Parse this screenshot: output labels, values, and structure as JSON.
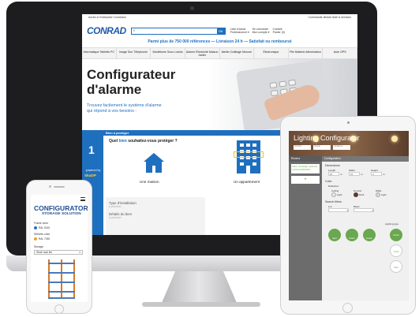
{
  "desktop": {
    "topbar_left": "Accès à l'entreprise   Connexion",
    "topbar_right": "Commande directe   Aide & services",
    "logo": "CONRAD",
    "search_placeholder": "",
    "search_button": "OK",
    "tools": [
      {
        "top": "Liste d'achat",
        "bottom": "Professionnel ▾"
      },
      {
        "top": "Se connecter",
        "bottom": "Mon compte ▾"
      },
      {
        "top": "0 article",
        "bottom": "Panier (0)"
      }
    ],
    "promo": "Parmi plus de 750 000 références — Livraison 24 h — Satisfait ou remboursé",
    "nav": [
      "Informatique Tablette PC",
      "Image Son Téléphonie",
      "Modélisme Sono Loisirs",
      "Alarme Électricité Maison Jardin",
      "Atelier Outillage Mesure",
      "Électronique",
      "Pile Batterie Alimentation",
      "Auto GPS"
    ],
    "hero_title_1": "Configurateur",
    "hero_title_2": "d'alarme",
    "hero_text": "Trouvez facilement le système d'alarme qui répond à vos besoins :",
    "step_bar": "Bien à protéger",
    "step_num": "1",
    "step_sub": "powered by",
    "step_brand": "SkuDP",
    "question_1": "Quel",
    "question_link": "bien",
    "question_2": "souhaitez-vous protéger ?",
    "option_house": "Une maison",
    "option_apartment": "Un appartement",
    "form_install_label": "Type d'installation",
    "form_install_value": "à préciser",
    "form_details_label": "Détails du bien",
    "form_details_value": "à préciser"
  },
  "tablet": {
    "title": "Lighting Configurator",
    "fields": [
      "Nombre",
      "Niveau",
      "Ambiance"
    ],
    "rooms_header": "Rooms",
    "room_item": "Salon (rectangle, plafond) CONFIGURATION",
    "add_button": "+",
    "config_header": "Configuration",
    "dimensions_label": "Dimensions",
    "dim_labels": [
      "Length",
      "Width",
      "Height"
    ],
    "dim_values": [
      "10",
      "15",
      "3"
    ],
    "dim_units": [
      "m",
      "m",
      "m"
    ],
    "color_label": "Color",
    "reflection_label": "Reflection",
    "reflection_options": [
      "Ceiling",
      "Ground",
      "Walls"
    ],
    "reflection_values": [
      "Light",
      "Dark",
      "Light"
    ],
    "search_filters_label": "Search filters",
    "filter_labels": [
      "Lux",
      "Beam"
    ],
    "lighting_type_label": "Lighting type",
    "lighting_types": [
      "Spot",
      "Down",
      "Linear",
      "Panel",
      "Track",
      "Strip"
    ],
    "colors": {
      "green": "#6aa84f",
      "banner": "#7a573f"
    }
  },
  "phone": {
    "title_1": "CONFIGURATOR",
    "title_2": "STORAGE SOLUTION",
    "frame_color_label": "Frame color",
    "frame_color_value": "RAL 5015",
    "shelves_color_label": "Shelves color",
    "shelves_color_value": "RAL 7035",
    "storage_label": "Storage",
    "storage_value": "Stock rack tier",
    "colors": {
      "frame": "#2f6fb6",
      "shelves": "#f0a030"
    }
  }
}
